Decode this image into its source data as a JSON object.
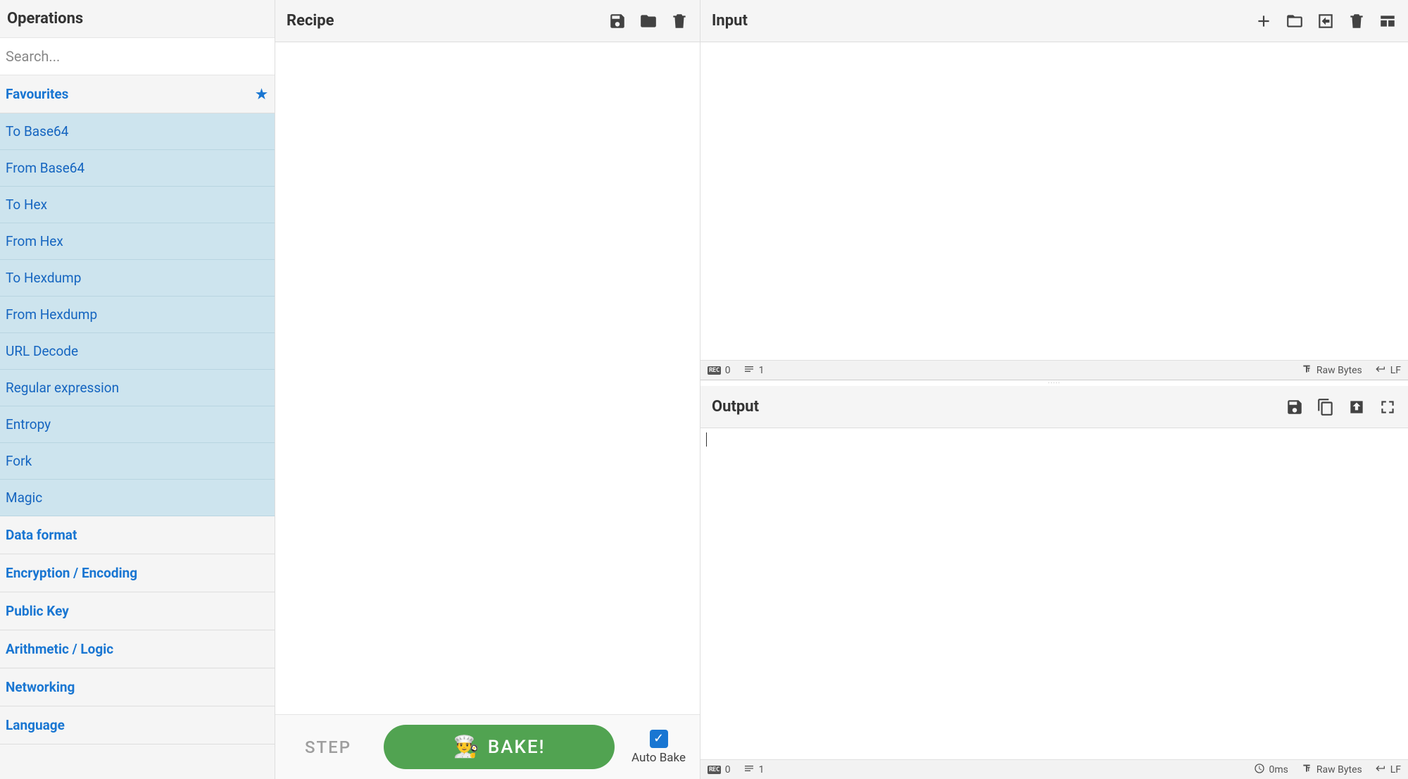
{
  "operations": {
    "title": "Operations",
    "search_placeholder": "Search...",
    "favourites_label": "Favourites",
    "favourites": [
      "To Base64",
      "From Base64",
      "To Hex",
      "From Hex",
      "To Hexdump",
      "From Hexdump",
      "URL Decode",
      "Regular expression",
      "Entropy",
      "Fork",
      "Magic"
    ],
    "categories": [
      "Data format",
      "Encryption / Encoding",
      "Public Key",
      "Arithmetic / Logic",
      "Networking",
      "Language"
    ]
  },
  "recipe": {
    "title": "Recipe",
    "step_label": "STEP",
    "bake_label": "BAKE!",
    "auto_bake_label": "Auto Bake",
    "auto_bake_checked": true
  },
  "input": {
    "title": "Input",
    "status": {
      "chars": "0",
      "lines": "1",
      "encoding": "Raw Bytes",
      "eol": "LF"
    }
  },
  "output": {
    "title": "Output",
    "status": {
      "chars": "0",
      "lines": "1",
      "time": "0ms",
      "encoding": "Raw Bytes",
      "eol": "LF"
    }
  }
}
